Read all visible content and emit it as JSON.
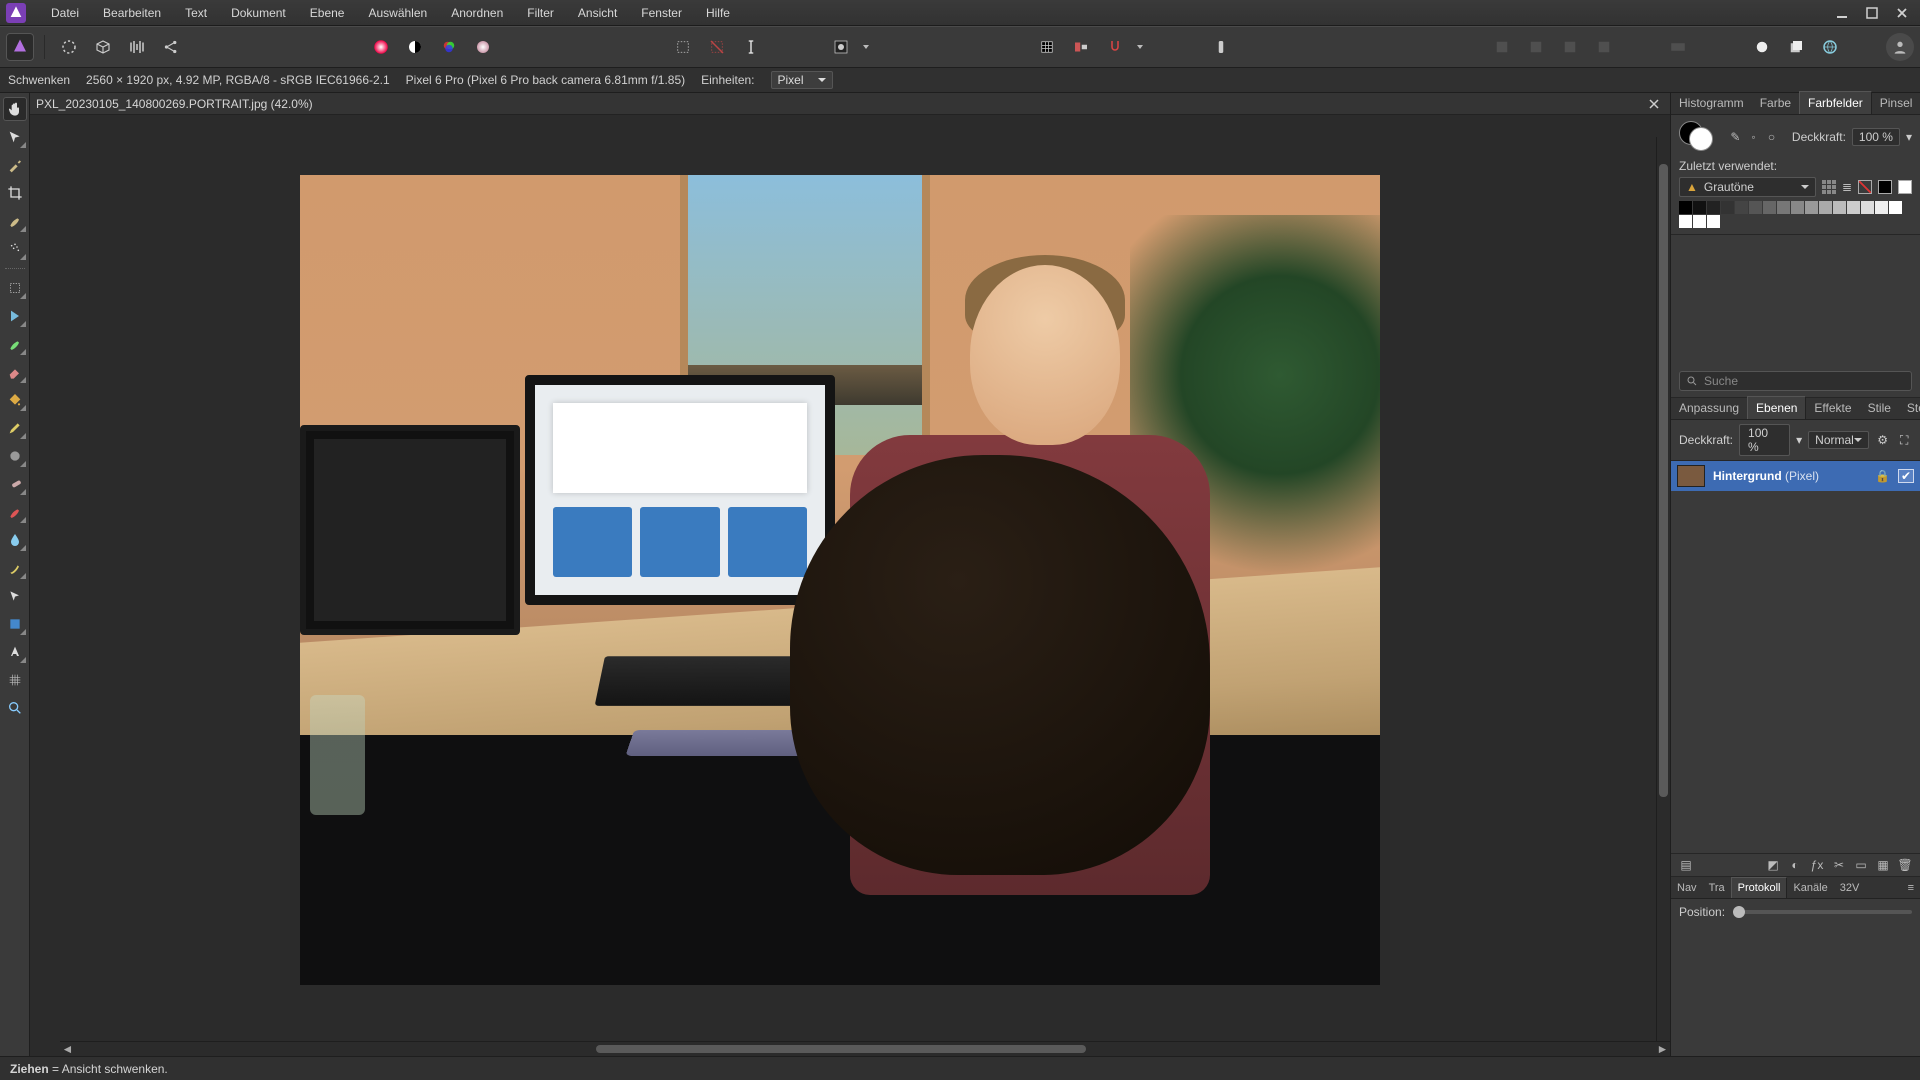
{
  "menus": [
    "Datei",
    "Bearbeiten",
    "Text",
    "Dokument",
    "Ebene",
    "Auswählen",
    "Anordnen",
    "Filter",
    "Ansicht",
    "Fenster",
    "Hilfe"
  ],
  "infobar": {
    "tool_label": "Schwenken",
    "doc_size": "2560 × 1920 px, 4.92 MP, RGBA/8 - sRGB IEC61966-2.1",
    "camera": "Pixel 6 Pro (Pixel 6 Pro back camera 6.81mm f/1.85)",
    "units_label": "Einheiten:",
    "units_value": "Pixel"
  },
  "document_tab": "PXL_20230105_140800269.PORTRAIT.jpg (42.0%)",
  "tools": [
    {
      "n": "hand",
      "active": true
    },
    {
      "n": "move",
      "active": false
    },
    {
      "n": "color-picker",
      "active": false
    },
    {
      "n": "crop",
      "active": false
    },
    {
      "n": "brush-1",
      "active": false
    },
    {
      "n": "brush-dots",
      "active": false
    },
    {
      "n": "marquee",
      "active": false
    },
    {
      "n": "flood-select",
      "active": false
    },
    {
      "n": "paint-brush",
      "active": false
    },
    {
      "n": "erase",
      "active": false
    },
    {
      "n": "clone",
      "active": false
    },
    {
      "n": "pencil",
      "active": false
    },
    {
      "n": "blur",
      "active": false
    },
    {
      "n": "heal",
      "active": false
    },
    {
      "n": "red-eye",
      "active": false
    },
    {
      "n": "drop",
      "active": false
    },
    {
      "n": "curve",
      "active": false
    },
    {
      "n": "arrow",
      "active": false
    },
    {
      "n": "shape",
      "active": false
    },
    {
      "n": "text",
      "active": false
    },
    {
      "n": "mesh",
      "active": false
    },
    {
      "n": "zoom",
      "active": false
    }
  ],
  "color_panel": {
    "tabs": [
      "Histogramm",
      "Farbe",
      "Farbfelder",
      "Pinsel"
    ],
    "active_tab": 2,
    "opacity_label": "Deckkraft:",
    "opacity_value": "100 %",
    "recent_label": "Zuletzt verwendet:",
    "palette_name": "Grautöne",
    "search_placeholder": "Suche"
  },
  "layers_panel": {
    "tabs": [
      "Anpassung",
      "Ebenen",
      "Effekte",
      "Stile",
      "Stock"
    ],
    "active_tab": 1,
    "opacity_label": "Deckkraft:",
    "opacity_value": "100 %",
    "blend_mode": "Normal",
    "layer_name": "Hintergrund",
    "layer_type": "(Pixel)"
  },
  "history_panel": {
    "tabs": [
      "Nav",
      "Tra",
      "Protokoll",
      "Kanäle",
      "32V"
    ],
    "active_tab": 2,
    "position_label": "Position:"
  },
  "statusbar": {
    "action": "Ziehen",
    "hint": "= Ansicht schwenken."
  },
  "grayscale_swatches": [
    "#000000",
    "#111111",
    "#222222",
    "#333333",
    "#444444",
    "#555555",
    "#666666",
    "#777777",
    "#888888",
    "#999999",
    "#aaaaaa",
    "#bbbbbb",
    "#cccccc",
    "#dddddd",
    "#eeeeee",
    "#ffffff",
    "#ffffff",
    "#ffffff",
    "#ffffff"
  ]
}
